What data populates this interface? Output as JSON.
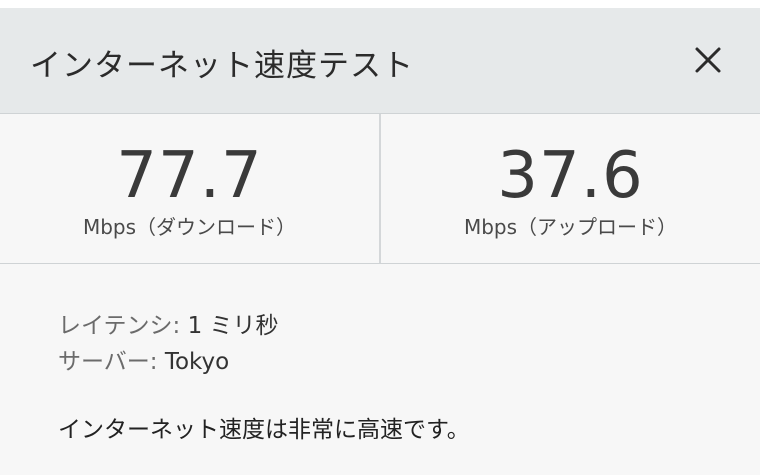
{
  "dialog": {
    "title": "インターネット速度テスト",
    "close_icon": "close-icon"
  },
  "download": {
    "value": "77.7",
    "unit": "Mbps（ダウンロード）"
  },
  "upload": {
    "value": "37.6",
    "unit": "Mbps（アップロード）"
  },
  "details": {
    "latency_label": "レイテンシ:",
    "latency_value": "1 ミリ秒",
    "server_label": "サーバー:",
    "server_value": "Tokyo"
  },
  "message": "インターネット速度は非常に高速です。",
  "colors": {
    "header_bg": "#e6e9ea",
    "body_bg": "#f7f7f7",
    "divider": "#cfd3d5"
  }
}
